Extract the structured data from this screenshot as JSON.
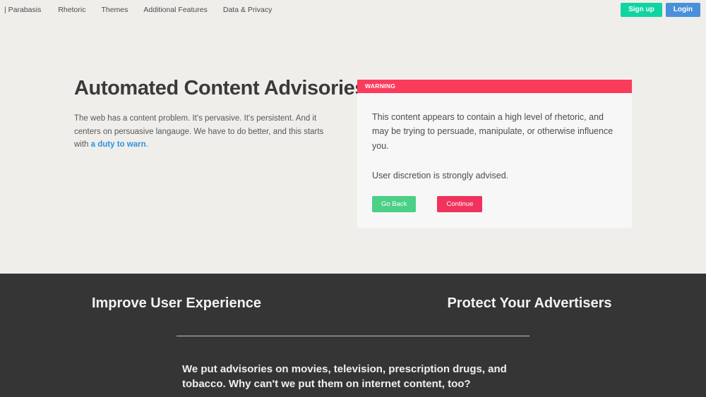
{
  "nav": {
    "items": [
      {
        "label": "| Parabasis",
        "name": "nav-item-parabasis"
      },
      {
        "label": "Rhetoric",
        "name": "nav-item-rhetoric"
      },
      {
        "label": "Themes",
        "name": "nav-item-themes"
      },
      {
        "label": "Additional Features",
        "name": "nav-item-additional-features"
      },
      {
        "label": "Data & Privacy",
        "name": "nav-item-data-privacy"
      }
    ],
    "signup_label": "Sign up",
    "login_label": "Login",
    "signup_color": "#10d4a2",
    "login_color": "#4a90d9"
  },
  "hero": {
    "title": "Automated Content Advisories",
    "sub_before": "The web has a content problem. It's pervasive. It's persistent. And it centers on persuasive langauge. We have to do better, and this starts with ",
    "sub_link": "a duty to warn",
    "sub_after": ".",
    "link_color": "#2f93e0"
  },
  "warning_card": {
    "header_label": "WARNING",
    "header_color": "#fb3b5c",
    "body_color": "#f7f7f7",
    "paragraph_1": "This content appears to contain a high level of rhetoric, and may be trying to persuade, manipulate, or otherwise influence you.",
    "paragraph_2": "User discretion is strongly advised.",
    "go_back_label": "Go Back",
    "go_back_color": "#4ccf86",
    "continue_label": "Continue",
    "continue_color": "#f0335c"
  },
  "dark_section": {
    "background": "#353535",
    "column_left_title": "Improve User Experience",
    "column_right_title": "Protect Your Advertisers",
    "lead": "We put advisories on movies, television, prescription drugs, and tobacco. Why can't we put them on internet content, too?"
  }
}
